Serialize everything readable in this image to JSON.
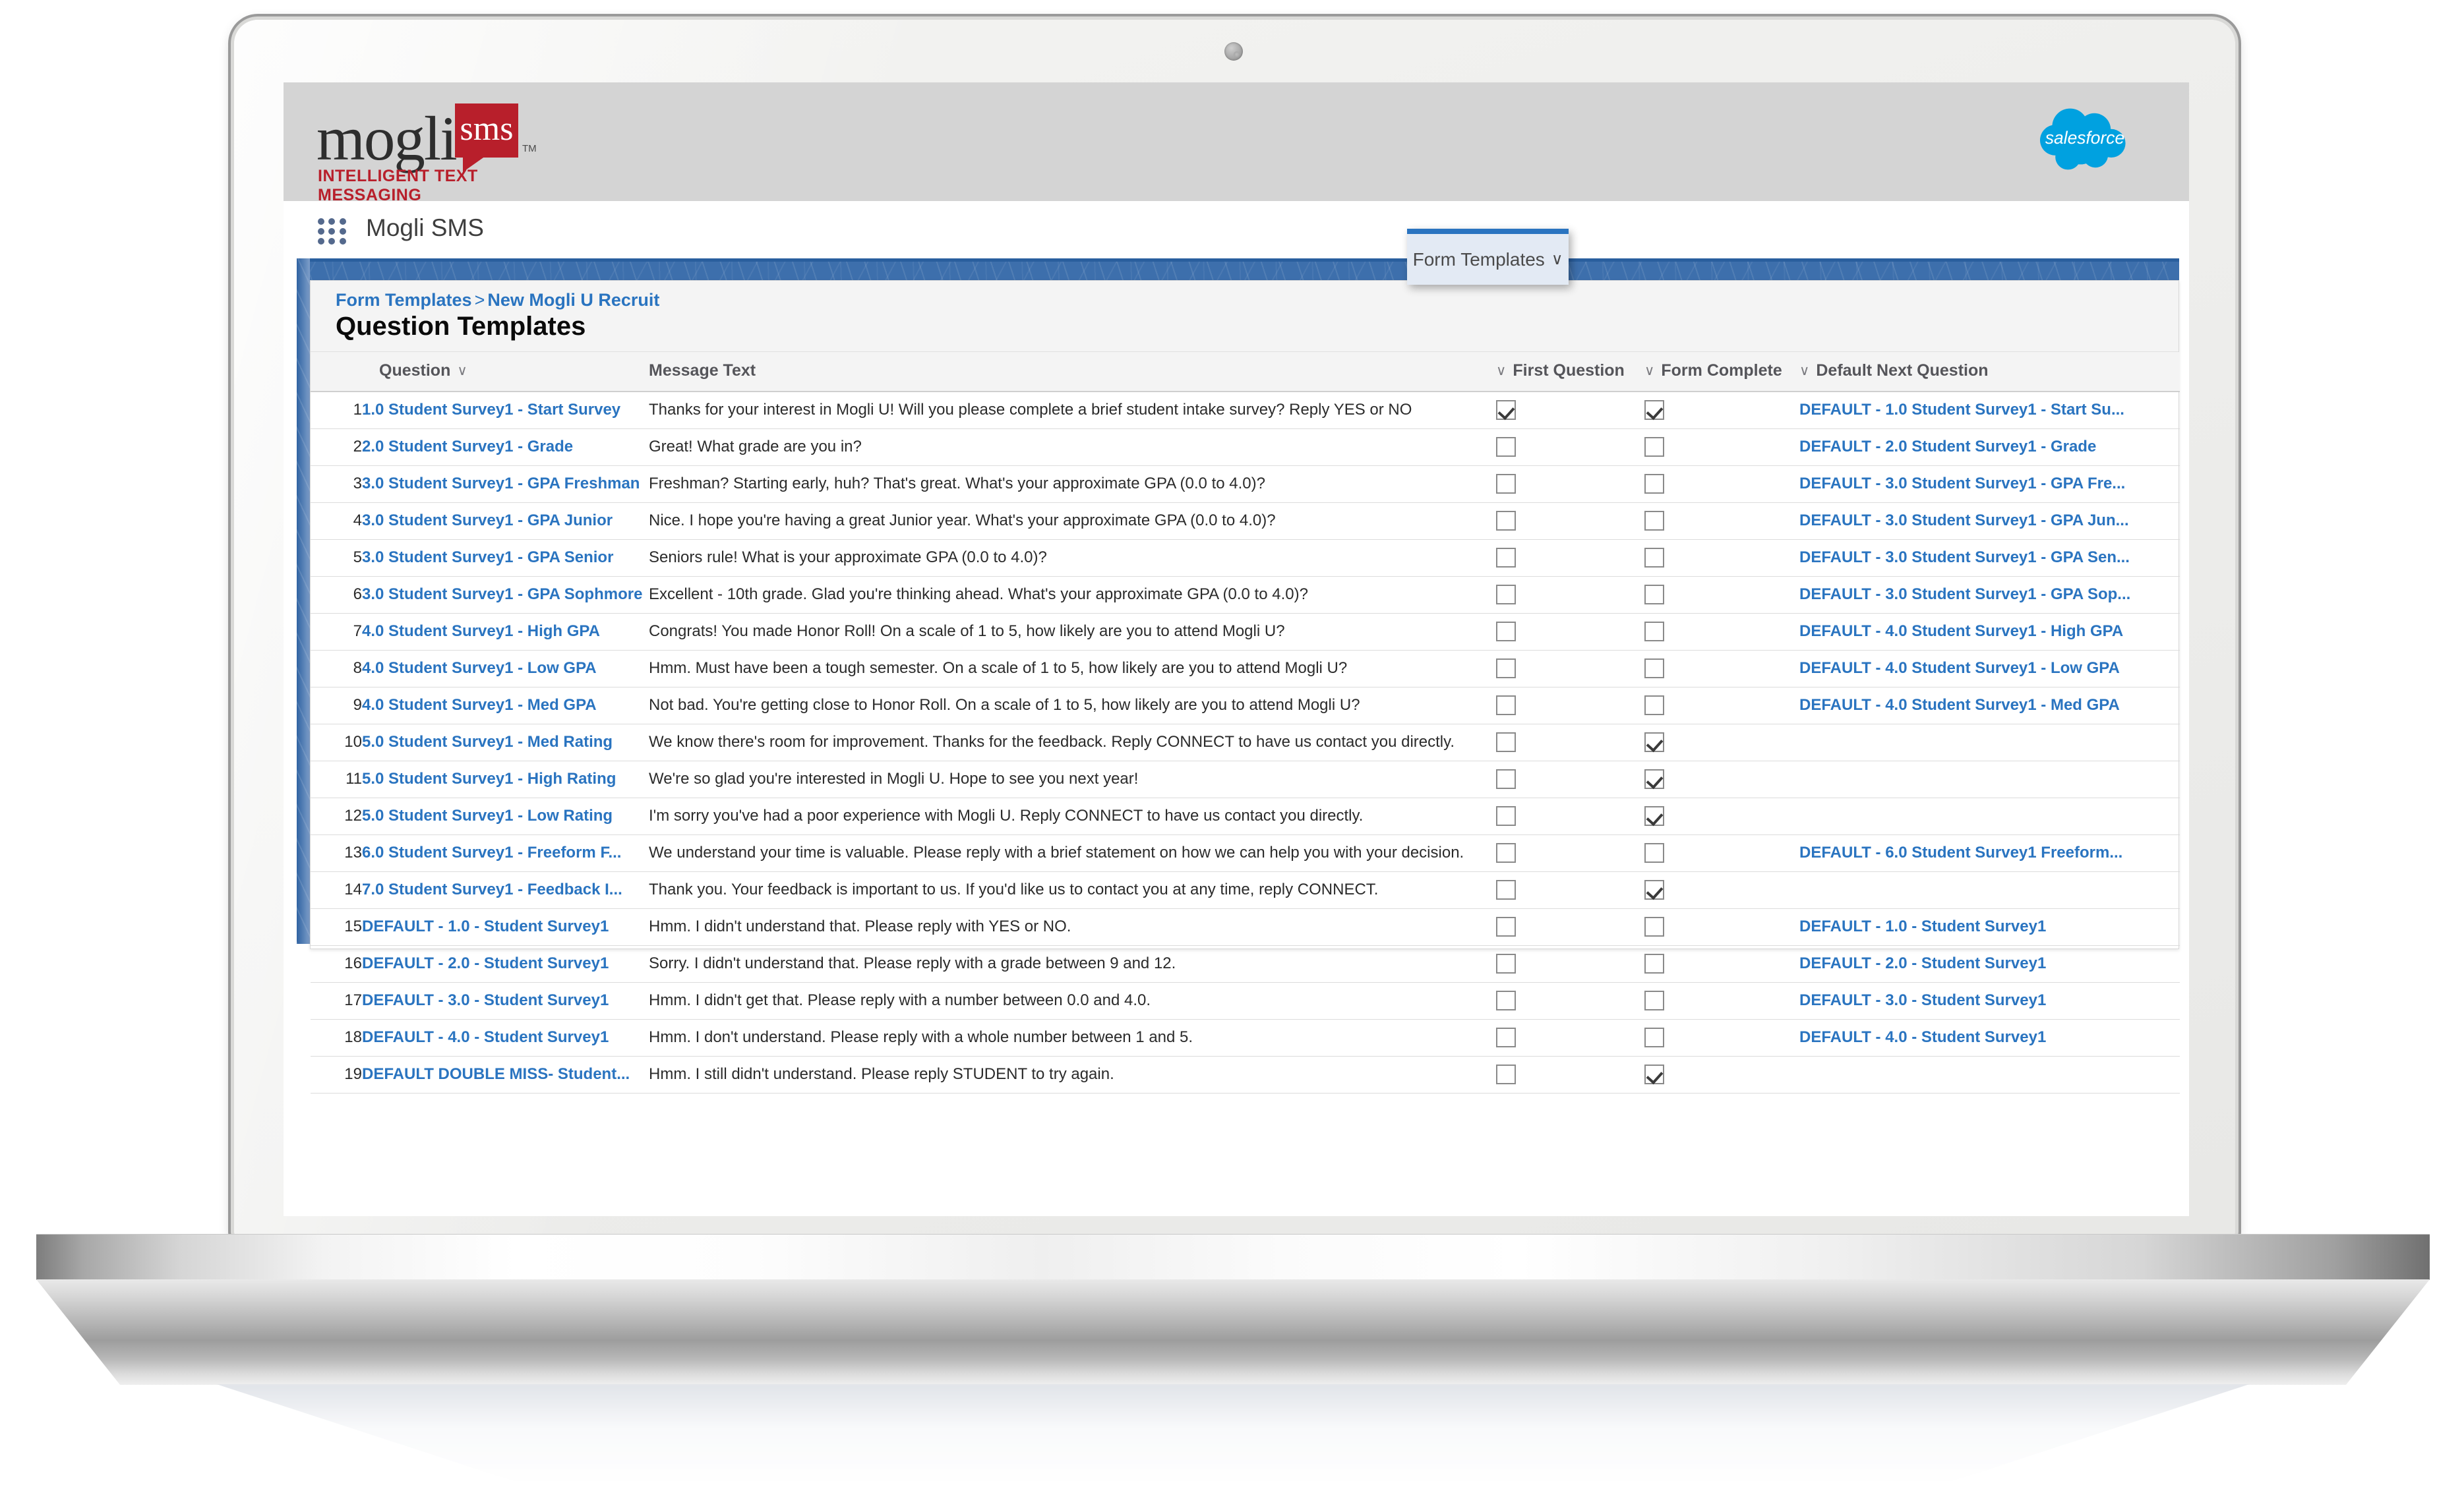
{
  "brand": {
    "logo_word": "mogli",
    "logo_badge": "sms",
    "logo_tm": "TM",
    "tagline": "INTELLIGENT TEXT MESSAGING",
    "salesforce_logo": "salesforce"
  },
  "nav": {
    "app_launcher_icon": "app-launcher-grid-icon",
    "app_name": "Mogli SMS"
  },
  "tab": {
    "label": "Form Templates",
    "chevron": "∨"
  },
  "header": {
    "breadcrumb_root": "Form  Templates",
    "breadcrumb_sep": ">",
    "breadcrumb_current": "New Mogli U Recruit",
    "title": "Question Templates"
  },
  "table": {
    "sort_chevron": "∨",
    "columns": [
      {
        "key": "num",
        "label": ""
      },
      {
        "key": "question",
        "label": "Question",
        "sortable": true
      },
      {
        "key": "message",
        "label": "Message Text",
        "sortable": false
      },
      {
        "key": "first_question",
        "label": "First Question",
        "sortable": true
      },
      {
        "key": "form_complete",
        "label": "Form Complete",
        "sortable": true
      },
      {
        "key": "default_next",
        "label": "Default Next Question",
        "sortable": true
      }
    ],
    "rows": [
      {
        "num": "1",
        "question": "1.0 Student Survey1 - Start Survey",
        "message": "Thanks for your interest in Mogli U! Will you please complete a brief student intake survey? Reply YES or NO",
        "first_question": true,
        "form_complete": true,
        "default_next": "DEFAULT - 1.0 Student Survey1 - Start Su..."
      },
      {
        "num": "2",
        "question": "2.0 Student Survey1 - Grade",
        "message": "Great! What grade are you in?",
        "first_question": false,
        "form_complete": false,
        "default_next": "DEFAULT - 2.0 Student Survey1 - Grade"
      },
      {
        "num": "3",
        "question": "3.0 Student Survey1 - GPA Freshman",
        "message": "Freshman? Starting early, huh? That's great. What's your approximate GPA (0.0 to 4.0)?",
        "first_question": false,
        "form_complete": false,
        "default_next": "DEFAULT - 3.0 Student Survey1 - GPA Fre..."
      },
      {
        "num": "4",
        "question": "3.0 Student Survey1 - GPA Junior",
        "message": "Nice. I hope you're having a great Junior year. What's your approximate GPA (0.0 to 4.0)?",
        "first_question": false,
        "form_complete": false,
        "default_next": "DEFAULT - 3.0 Student Survey1 - GPA Jun..."
      },
      {
        "num": "5",
        "question": "3.0 Student Survey1 - GPA Senior",
        "message": "Seniors rule!  What is your approximate GPA (0.0 to 4.0)?",
        "first_question": false,
        "form_complete": false,
        "default_next": "DEFAULT - 3.0 Student Survey1 - GPA Sen..."
      },
      {
        "num": "6",
        "question": "3.0 Student Survey1 - GPA Sophmore",
        "message": "Excellent - 10th grade. Glad you're thinking ahead. What's your approximate GPA (0.0 to 4.0)?",
        "first_question": false,
        "form_complete": false,
        "default_next": "DEFAULT - 3.0 Student Survey1 - GPA Sop..."
      },
      {
        "num": "7",
        "question": "4.0 Student Survey1 - High GPA",
        "message": "Congrats! You made Honor Roll! On a scale of 1 to 5, how likely are you to attend Mogli U?",
        "first_question": false,
        "form_complete": false,
        "default_next": "DEFAULT - 4.0 Student Survey1 - High GPA"
      },
      {
        "num": "8",
        "question": "4.0 Student Survey1 - Low GPA",
        "message": "Hmm. Must have been a tough semester. On a scale of 1 to 5, how likely are you to attend Mogli U?",
        "first_question": false,
        "form_complete": false,
        "default_next": "DEFAULT - 4.0 Student Survey1 - Low GPA"
      },
      {
        "num": "9",
        "question": "4.0 Student Survey1 - Med GPA",
        "message": "Not bad. You're getting close to Honor Roll. On a scale of 1 to 5, how likely are you to attend Mogli U?",
        "first_question": false,
        "form_complete": false,
        "default_next": "DEFAULT - 4.0 Student Survey1 - Med GPA"
      },
      {
        "num": "10",
        "question": "5.0 Student Survey1 - Med Rating",
        "message": "We know there's room for improvement. Thanks for the feedback. Reply CONNECT to have us contact you directly.",
        "first_question": false,
        "form_complete": true,
        "default_next": ""
      },
      {
        "num": "11",
        "question": "5.0 Student Survey1 - High Rating",
        "message": "We're so glad you're interested in Mogli U. Hope to see you next year!",
        "first_question": false,
        "form_complete": true,
        "default_next": ""
      },
      {
        "num": "12",
        "question": "5.0 Student Survey1 - Low Rating",
        "message": "I'm sorry you've had a poor experience with Mogli U. Reply CONNECT to have us contact you directly.",
        "first_question": false,
        "form_complete": true,
        "default_next": ""
      },
      {
        "num": "13",
        "question": "6.0 Student Survey1 -  Freeform F...",
        "message": "We understand your time is valuable. Please reply with a brief statement on how we can help you with your decision.",
        "first_question": false,
        "form_complete": false,
        "default_next": "DEFAULT - 6.0 Student Survey1 Freeform..."
      },
      {
        "num": "14",
        "question": "7.0 Student Survey1 - Feedback I...",
        "message": "Thank you. Your feedback is important to us. If you'd like us to contact you at any time, reply CONNECT.",
        "first_question": false,
        "form_complete": true,
        "default_next": ""
      },
      {
        "num": "15",
        "question": "DEFAULT - 1.0 - Student Survey1",
        "message": "Hmm. I didn't understand that. Please reply with YES or NO.",
        "first_question": false,
        "form_complete": false,
        "default_next": "DEFAULT - 1.0 - Student Survey1"
      },
      {
        "num": "16",
        "question": "DEFAULT - 2.0 - Student Survey1",
        "message": "Sorry. I didn't understand that. Please reply with a grade between 9 and 12.",
        "first_question": false,
        "form_complete": false,
        "default_next": "DEFAULT - 2.0 - Student Survey1"
      },
      {
        "num": "17",
        "question": "DEFAULT - 3.0 - Student Survey1",
        "message": "Hmm. I didn't get that. Please reply with a number between 0.0 and 4.0.",
        "first_question": false,
        "form_complete": false,
        "default_next": "DEFAULT - 3.0 - Student Survey1"
      },
      {
        "num": "18",
        "question": "DEFAULT - 4.0 - Student Survey1",
        "message": "Hmm. I don't understand. Please reply with a whole number between 1 and 5.",
        "first_question": false,
        "form_complete": false,
        "default_next": "DEFAULT - 4.0 - Student Survey1"
      },
      {
        "num": "19",
        "question": "DEFAULT DOUBLE MISS- Student...",
        "message": "Hmm. I still didn't understand. Please reply STUDENT to try again.",
        "first_question": false,
        "form_complete": true,
        "default_next": ""
      }
    ]
  },
  "colors": {
    "link_blue": "#2a74c0",
    "banner_blue": "#3d6fac",
    "brand_red": "#b81f2b",
    "salesforce_blue": "#00a1e0",
    "logo_band_gray": "#d4d4d4"
  }
}
